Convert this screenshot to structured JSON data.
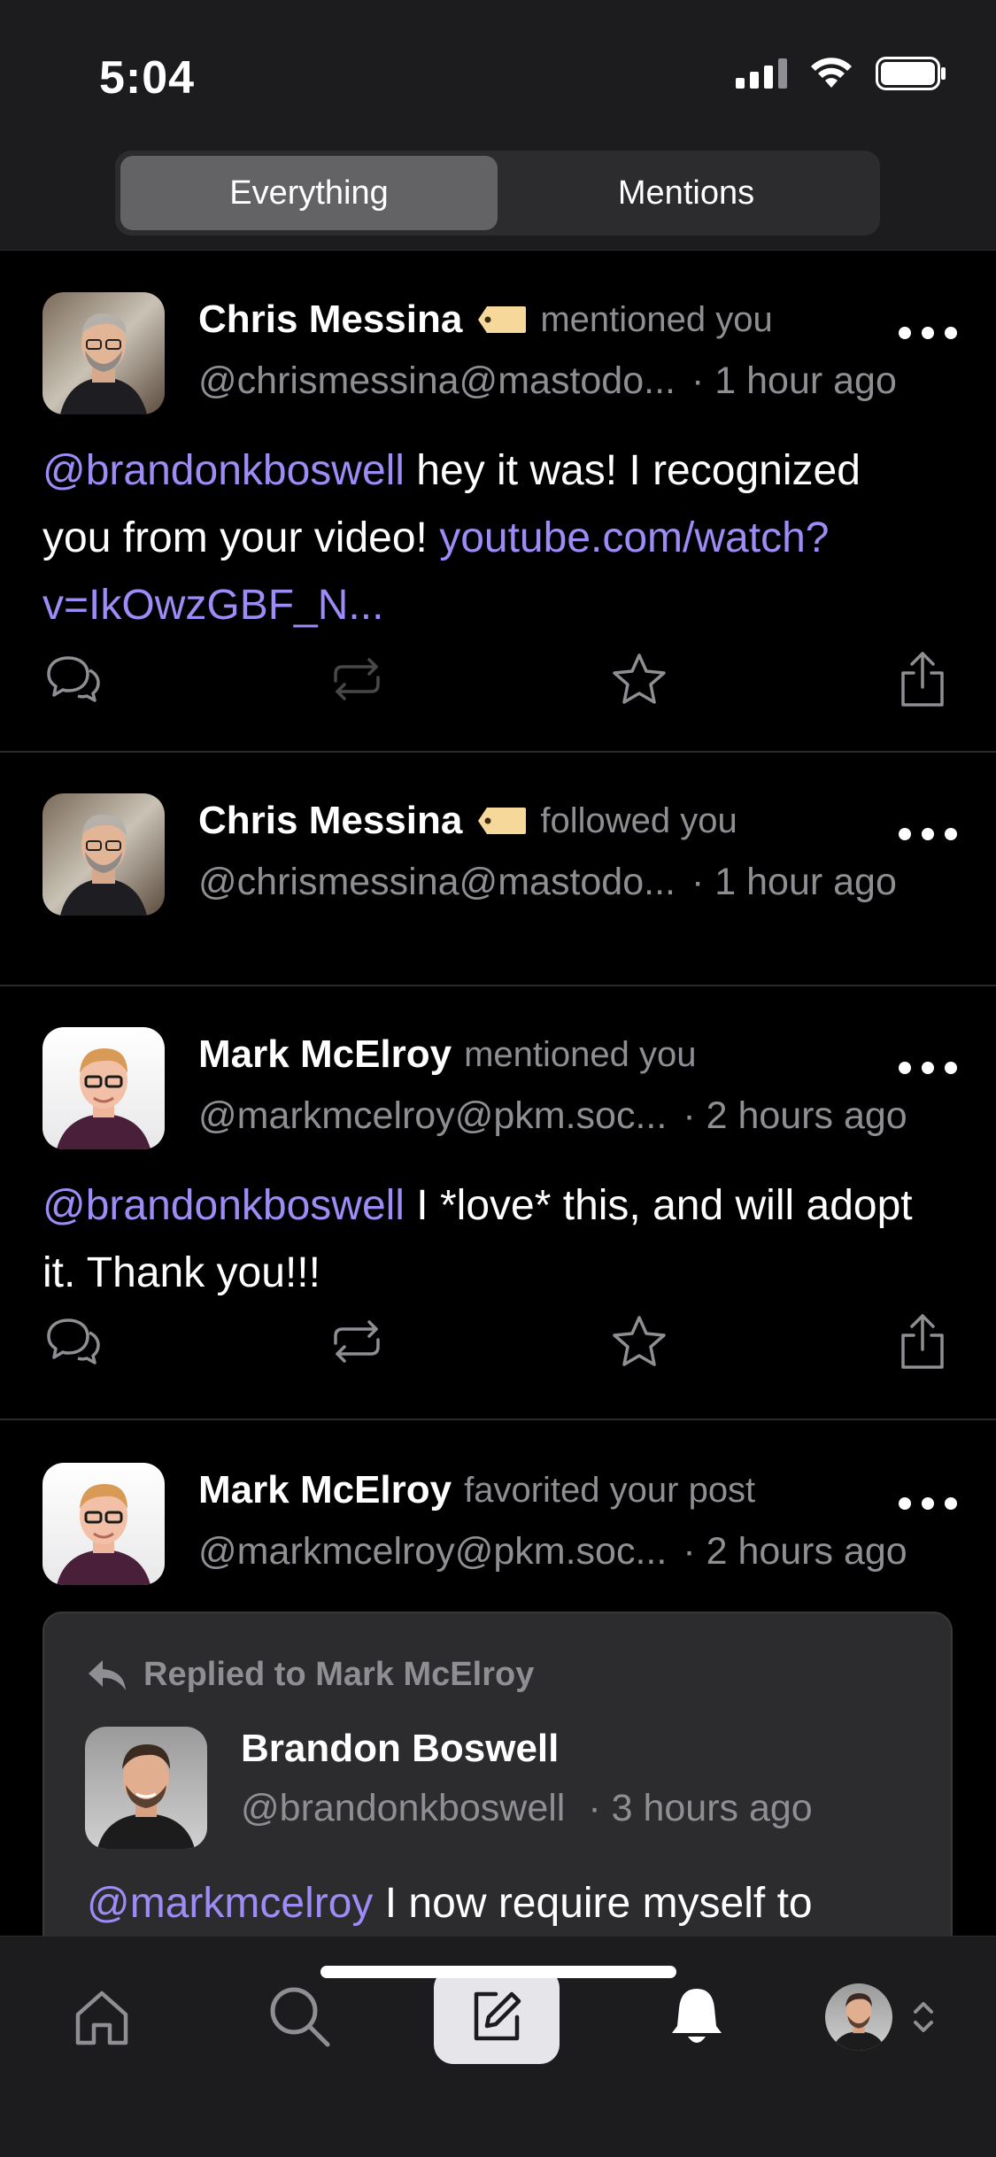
{
  "status_bar": {
    "time": "5:04"
  },
  "tabs": {
    "everything": "Everything",
    "mentions": "Mentions",
    "active": "everything"
  },
  "feed": [
    {
      "display_name": "Chris Messina",
      "action": "mentioned you",
      "handle": "@chrismessina@mastodo...",
      "time": "· 1 hour ago",
      "body_mention": "@brandonkboswell",
      "body_text": " hey it was! I recognized you from your video! ",
      "body_link": "youtube.com/watch?v=IkOwzGBF_N..."
    },
    {
      "display_name": "Chris Messina",
      "action": "followed you",
      "handle": "@chrismessina@mastodo...",
      "time": "· 1 hour ago"
    },
    {
      "display_name": "Mark McElroy",
      "action": "mentioned you",
      "handle": "@markmcelroy@pkm.soc...",
      "time": "· 2 hours ago",
      "body_mention": "@brandonkboswell",
      "body_text": " I *love* this, and will adopt it. Thank you!!!"
    },
    {
      "display_name": "Mark McElroy",
      "action": "favorited your post",
      "handle": "@markmcelroy@pkm.soc...",
      "time": "· 2 hours ago"
    }
  ],
  "quoted_post": {
    "reply_label": "Replied to Mark McElroy",
    "display_name": "Brandon Boswell",
    "handle": "@brandonkboswell",
    "time": "· 3 hours ago",
    "body_mention": "@markmcelroy",
    "body_text": " I now require myself to"
  },
  "tab_bar": {
    "items": [
      "home-icon",
      "search-icon",
      "compose-icon",
      "bell-icon",
      "profile-avatar"
    ]
  },
  "colors": {
    "background": "#000000",
    "chrome": "#1c1c1e",
    "accent_link": "#9d8cf6",
    "secondary_text": "#8e8e93",
    "tag_icon": "#f5d89a"
  }
}
